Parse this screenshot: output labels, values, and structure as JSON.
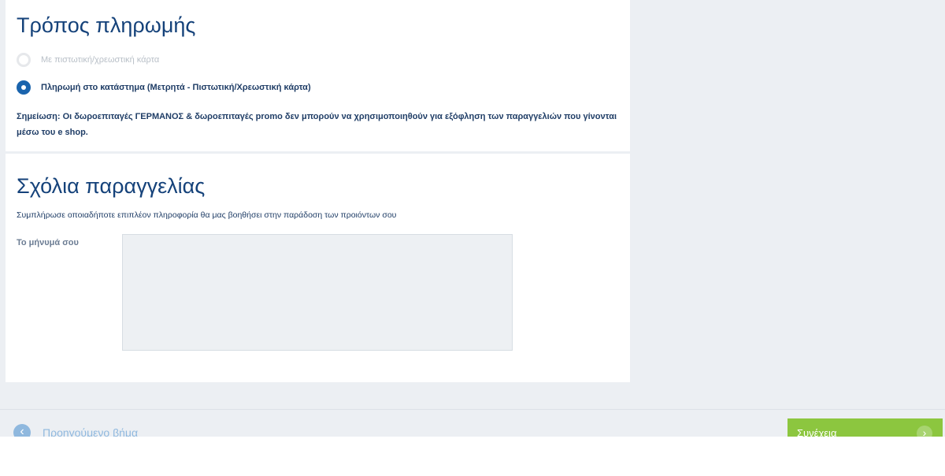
{
  "payment": {
    "title": "Τρόπος πληρωμής",
    "options": [
      {
        "label": "Με πιστωτική/χρεωστική κάρτα",
        "selected": false
      },
      {
        "label": "Πληρωμή στο κατάστημα (Μετρητά - Πιστωτική/Χρεωστική κάρτα)",
        "selected": true
      }
    ],
    "note": "Σημείωση: Οι δωροεπιταγές ΓΕΡΜΑΝΟΣ & δωροεπιταγές promo δεν μπορούν να χρησιμοποιηθούν για εξόφληση των παραγγελιών που γίνονται μέσω του e shop."
  },
  "notes": {
    "title": "Σχόλια παραγγελίας",
    "helper": "Συμπλήρωσε οποιαδήποτε επιπλέον πληροφορία θα μας βοηθήσει στην παράδοση των προιόντων σου",
    "message_label": "Το μήνυμά σου",
    "message_value": ""
  },
  "footer": {
    "prev_label": "Προηγούμενο βήμα",
    "prev_icon": "chevron-left-icon",
    "next_label": "Συνέχεια",
    "next_icon": "chevron-right-icon",
    "next_color": "#8cc63f"
  },
  "colors": {
    "heading": "#15427a",
    "accent": "#1a64ad",
    "background": "#eceff3"
  }
}
